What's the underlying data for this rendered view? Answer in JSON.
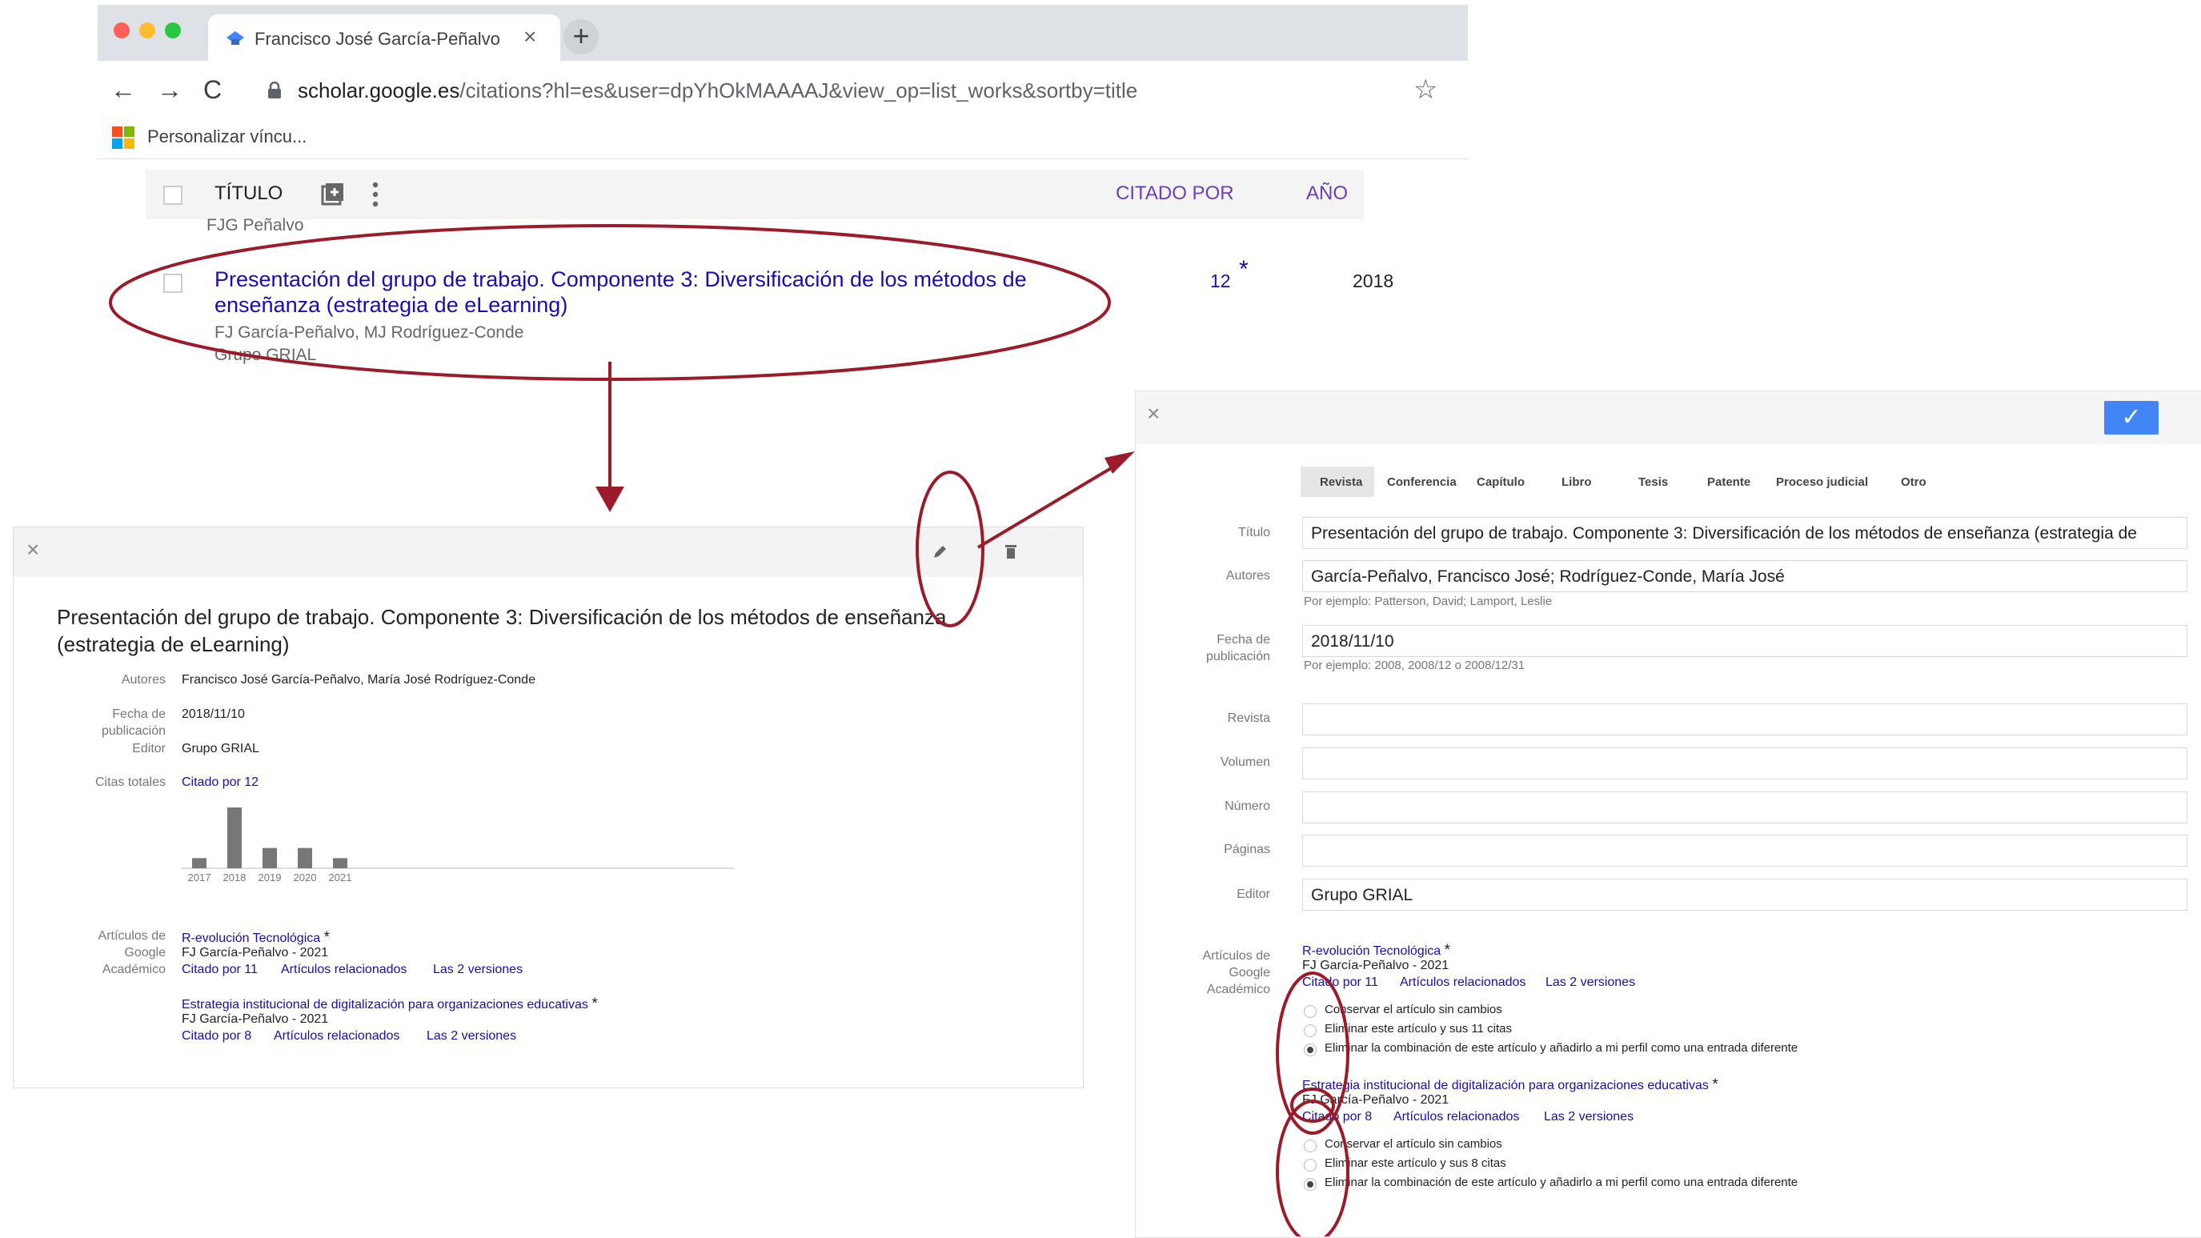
{
  "browser": {
    "tab_title": "Francisco José García-Peñalvo",
    "url_host": "scholar.google.es",
    "url_path": "/citations?hl=es&user=dpYhOkMAAAAJ&view_op=list_works&sortby=title",
    "bookmark": "Personalizar víncu..."
  },
  "list": {
    "col_title": "TÍTULO",
    "col_cited": "CITADO POR",
    "col_year": "AÑO",
    "prev_authors": "FJG Peñalvo",
    "row": {
      "title_line1": "Presentación del grupo de trabajo. Componente 3: Diversificación de los métodos de",
      "title_line2": "enseñanza (estrategia de eLearning)",
      "authors": "FJ García-Peñalvo, MJ Rodríguez-Conde",
      "publisher": "Grupo GRIAL",
      "cited": "12",
      "star": "*",
      "year": "2018"
    }
  },
  "view": {
    "title_line1": "Presentación del grupo de trabajo. Componente 3: Diversificación de los métodos de enseñanza",
    "title_line2": "(estrategia de eLearning)",
    "authors_label": "Autores",
    "authors": "Francisco José García-Peñalvo, María José Rodríguez-Conde",
    "date_label1": "Fecha de",
    "date_label2": "publicación",
    "date": "2018/11/10",
    "editor_label": "Editor",
    "editor": "Grupo GRIAL",
    "citations_label": "Citas totales",
    "citations_link": "Citado por 12",
    "scholar_label1": "Artículos de",
    "scholar_label2": "Google",
    "scholar_label3": "Académico",
    "articles": [
      {
        "title": "R-evolución Tecnológica",
        "star": "*",
        "meta": "FJ García-Peñalvo - 2021",
        "cited": "Citado por 11",
        "related": "Artículos relacionados",
        "versions": "Las 2 versiones"
      },
      {
        "title": "Estrategia institucional de digitalización para organizaciones educativas",
        "star": "*",
        "meta": "FJ García-Peñalvo - 2021",
        "cited": "Citado por 8",
        "related": "Artículos relacionados",
        "versions": "Las 2 versiones"
      }
    ]
  },
  "chart_data": {
    "type": "bar",
    "categories": [
      "2017",
      "2018",
      "2019",
      "2020",
      "2021"
    ],
    "values": [
      1,
      6,
      2,
      2,
      1
    ],
    "ylim": [
      0,
      6
    ],
    "color": "#777777"
  },
  "edit": {
    "tabs": [
      "Revista",
      "Conferencia",
      "Capítulo",
      "Libro",
      "Tesis",
      "Patente",
      "Proceso judicial",
      "Otro"
    ],
    "title_label": "Título",
    "title_value": "Presentación del grupo de trabajo. Componente 3: Diversificación de los métodos de enseñanza (estrategia de",
    "authors_label": "Autores",
    "authors_value": "García-Peñalvo, Francisco José; Rodríguez-Conde, María José",
    "authors_hint": "Por ejemplo: Patterson, David; Lamport, Leslie",
    "date_label1": "Fecha de",
    "date_label2": "publicación",
    "date_value": "2018/11/10",
    "date_hint": "Por ejemplo: 2008, 2008/12 o 2008/12/31",
    "journal_label": "Revista",
    "volume_label": "Volumen",
    "number_label": "Número",
    "pages_label": "Páginas",
    "editor_label": "Editor",
    "editor_value": "Grupo GRIAL",
    "scholar_label1": "Artículos de",
    "scholar_label2": "Google",
    "scholar_label3": "Académico",
    "articles": [
      {
        "title": "R-evolución Tecnológica",
        "star": "*",
        "meta": "FJ García-Peñalvo - 2021",
        "cited": "Citado por 11",
        "related": "Artículos relacionados",
        "versions": "Las 2 versiones",
        "options": [
          "Conservar el artículo sin cambios",
          "Eliminar este artículo y sus 11 citas",
          "Eliminar la combinación de este artículo y añadirlo a mi perfil como una entrada diferente"
        ]
      },
      {
        "title": "Estrategia institucional de digitalización para organizaciones educativas",
        "star": "*",
        "meta": "FJ García-Peñalvo - 2021",
        "cited": "Citado por 8",
        "related": "Artículos relacionados",
        "versions": "Las 2 versiones",
        "options": [
          "Conservar el artículo sin cambios",
          "Eliminar este artículo y sus 8 citas",
          "Eliminar la combinación de este artículo y añadirlo a mi perfil como una entrada diferente"
        ]
      }
    ]
  },
  "colors": {
    "annotation": "#9b1b2a",
    "link": "#1a0dab",
    "accent": "#4285f4"
  }
}
